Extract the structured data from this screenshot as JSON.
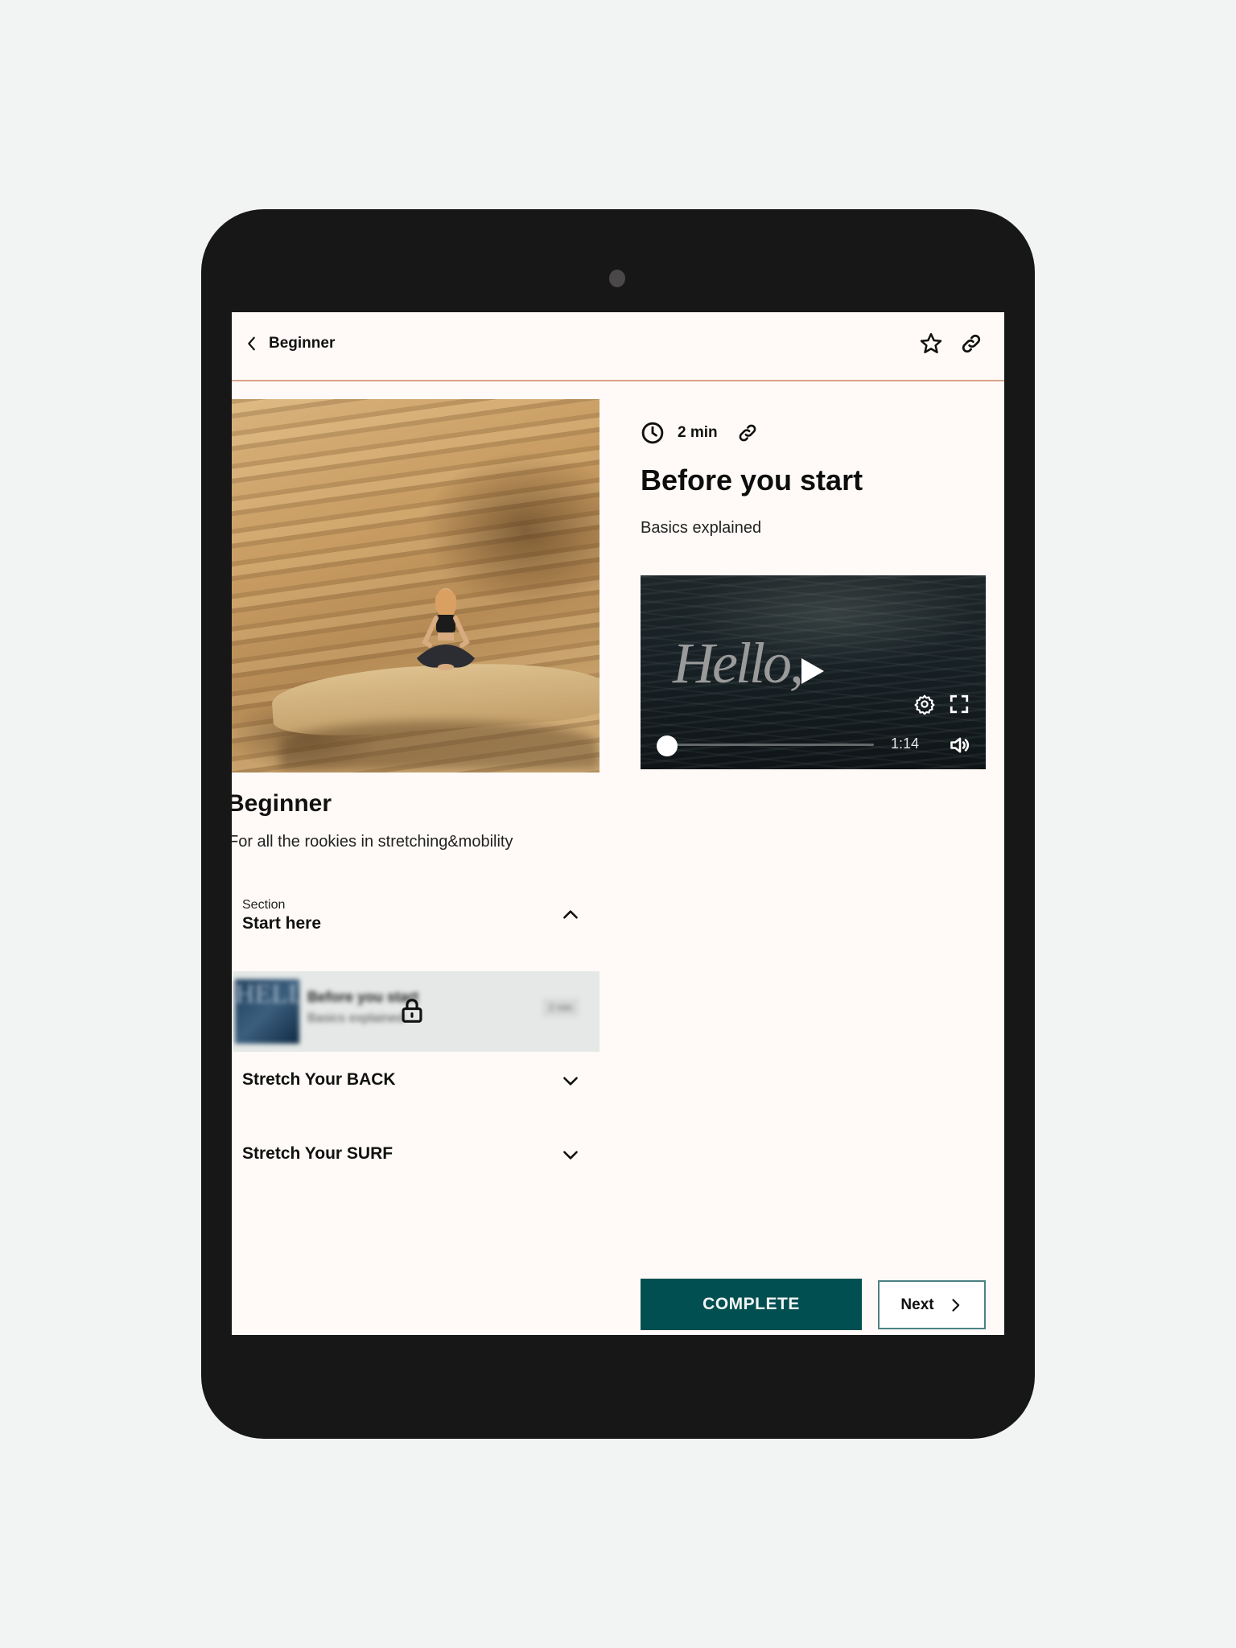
{
  "header": {
    "back_label": "Beginner",
    "icons": {
      "back": "chevron-left-icon",
      "favorite": "star-icon",
      "share": "link-icon"
    }
  },
  "course": {
    "title": "Beginner",
    "description": "For all the rookies in stretching&mobility",
    "hero_image": "woman-meditating-on-sandstone-rock"
  },
  "sections": [
    {
      "label": "Section",
      "name": "Start here",
      "expanded": true,
      "lessons": [
        {
          "title": "Before you start",
          "subtitle": "Basics explained",
          "duration": "2 min",
          "thumb_text": "HELLO",
          "locked": true
        }
      ]
    },
    {
      "name": "Stretch Your BACK",
      "expanded": false
    },
    {
      "name": "Stretch Your SURF",
      "expanded": false
    }
  ],
  "lesson": {
    "duration": "2 min",
    "title": "Before you start",
    "subtitle": "Basics explained"
  },
  "video": {
    "overlay_text": "Hello,",
    "time": "1:14",
    "progress": 0,
    "icons": {
      "play": "play-icon",
      "settings": "gear-icon",
      "fullscreen": "fullscreen-icon",
      "volume": "volume-icon"
    }
  },
  "actions": {
    "complete_label": "COMPLETE",
    "next_label": "Next"
  },
  "colors": {
    "accent": "#014f51",
    "header_divider": "#d9a48a",
    "screen_bg": "#fffaf7",
    "device": "#171717",
    "page_bg": "#f2f3f3"
  }
}
